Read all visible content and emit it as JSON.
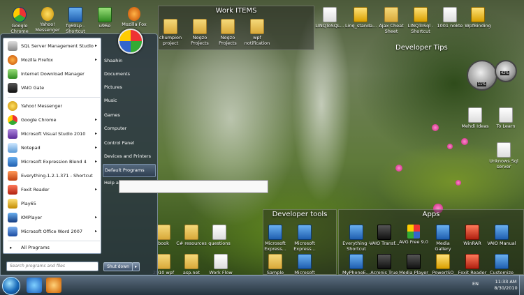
{
  "desktop": {
    "top_icons": [
      "Google Chrome",
      "Yahoo! Messenger",
      "fg69Lp - Shortcut",
      "u96e",
      "Mozilla Fox"
    ],
    "fences": {
      "work_items": {
        "title": "Work ITEMS",
        "items": [
          "LINQToSQL...",
          "Linq_standa...",
          "Ajax Cheat Sheet",
          "LINQToSql - Shortcut",
          "1001 nokte",
          "WpfBinding"
        ],
        "folders": [
          "chumpion project",
          "Negzo Projects",
          "Negzo Projects",
          "wpf notification"
        ]
      },
      "developer_tips": {
        "title": "Developer Tips",
        "items": [
          "Mehdi Ideas",
          "To Learn",
          "Unknows Sql server"
        ]
      },
      "developer_tools": {
        "title": "Developer tools",
        "items": [
          "book",
          "C# resources",
          "questions",
          "Microsoft Express...",
          "Microsoft Express...",
          "2010 wpf",
          "asp.net",
          "Work Flow",
          "Sample",
          "Microsoft"
        ]
      },
      "apps": {
        "title": "Apps",
        "items": [
          "Everything - Shortcut",
          "VAIO Transf...",
          "AVG Free 9.0",
          "Media Gallery",
          "WinRAR",
          "VAIO Manual",
          "MyPhoneE...",
          "Acronis True",
          "Media Player",
          "PowerISO",
          "Foxit Reader",
          "Customize"
        ]
      }
    },
    "gauges": {
      "cpu": "11%",
      "mem": "42%"
    }
  },
  "start_menu": {
    "programs": [
      {
        "label": "SQL Server Management Studio",
        "arrow": true
      },
      {
        "label": "Mozilla Firefox",
        "arrow": true
      },
      {
        "label": "Internet Download Manager",
        "arrow": false
      },
      {
        "label": "VAIO Gate",
        "arrow": false
      },
      {
        "label": "Yahoo! Messenger",
        "arrow": false
      },
      {
        "label": "Google Chrome",
        "arrow": true
      },
      {
        "label": "Microsoft Visual Studio 2010",
        "arrow": true
      },
      {
        "label": "Notepad",
        "arrow": true
      },
      {
        "label": "Microsoft Expression Blend 4",
        "arrow": true
      },
      {
        "label": "Everything-1.2.1.371 - Shortcut",
        "arrow": false
      },
      {
        "label": "Foxit Reader",
        "arrow": true
      },
      {
        "label": "Play65",
        "arrow": false
      },
      {
        "label": "KMPlayer",
        "arrow": true
      },
      {
        "label": "Microsoft Office Word 2007",
        "arrow": true
      }
    ],
    "arrow_glyph": "▸",
    "all_programs": "All Programs",
    "search_placeholder": "Search programs and files",
    "right_items": [
      "Shaahin",
      "Documents",
      "Pictures",
      "Music",
      "Games",
      "Computer",
      "Control Panel",
      "Devices and Printers",
      "Default Programs",
      "Help a"
    ],
    "selected_right_item": "Default Programs",
    "shutdown": "Shut down",
    "shutdown_arrow": "▸"
  },
  "taskbar": {
    "language": "EN",
    "time": "11:33 AM",
    "date": "8/30/2010"
  }
}
